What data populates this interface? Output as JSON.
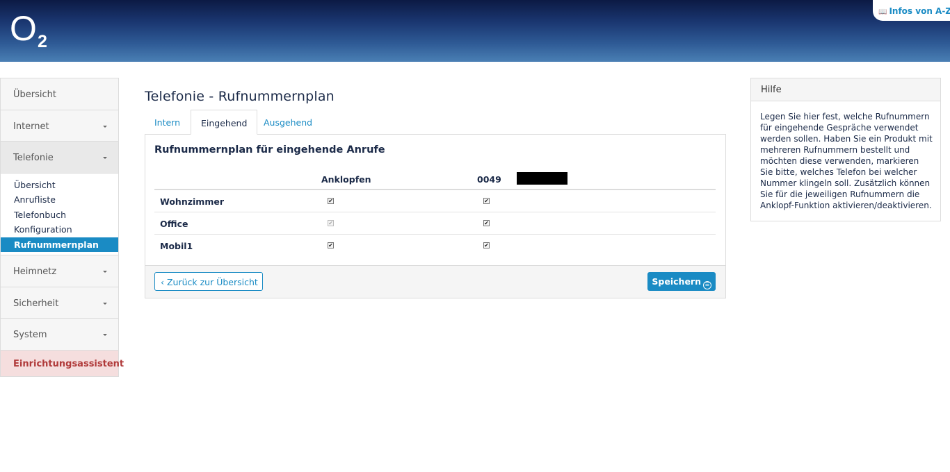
{
  "header": {
    "logo_text": "O",
    "logo_sub": "2",
    "infos_label": "Infos von A-Z"
  },
  "sidebar": {
    "items": [
      {
        "label": "Übersicht"
      },
      {
        "label": "Internet"
      },
      {
        "label": "Telefonie"
      },
      {
        "label": "Heimnetz"
      },
      {
        "label": "Sicherheit"
      },
      {
        "label": "System"
      }
    ],
    "telefonie_sub": [
      {
        "label": "Übersicht"
      },
      {
        "label": "Anrufliste"
      },
      {
        "label": "Telefonbuch"
      },
      {
        "label": "Konfiguration"
      },
      {
        "label": "Rufnummernplan"
      }
    ],
    "wizard_label": "Einrichtungsassistent"
  },
  "main": {
    "page_title": "Telefonie - Rufnummernplan",
    "tabs": [
      {
        "label": "Intern"
      },
      {
        "label": "Eingehend"
      },
      {
        "label": "Ausgehend"
      }
    ],
    "panel_title": "Rufnummernplan für eingehende Anrufe",
    "columns": {
      "anklopfen": "Anklopfen",
      "number": "0049"
    },
    "rows": [
      {
        "label": "Wohnzimmer",
        "anklopfen": true,
        "number": true,
        "anklopfen_disabled": false
      },
      {
        "label": "Office",
        "anklopfen": true,
        "number": true,
        "anklopfen_disabled": true
      },
      {
        "label": "Mobil1",
        "anklopfen": true,
        "number": true,
        "anklopfen_disabled": false
      }
    ],
    "back_label": "Zurück zur Übersicht",
    "save_label": "Speichern"
  },
  "help": {
    "title": "Hilfe",
    "text": "Legen Sie hier fest, welche Rufnummern für eingehende Gespräche verwendet werden sollen. Haben Sie ein Produkt mit mehreren Rufnummern bestellt und möchten diese verwenden, markieren Sie bitte, welches Telefon bei welcher Nummer klingeln soll. Zusätzlich können Sie für die jeweiligen Rufnummern die Anklopf-Funktion aktivieren/deaktivieren."
  },
  "colors": {
    "accent": "#1a8bc4",
    "text": "#1b2a48",
    "wizard_bg": "#f5dede",
    "wizard_text": "#b03a3a"
  }
}
